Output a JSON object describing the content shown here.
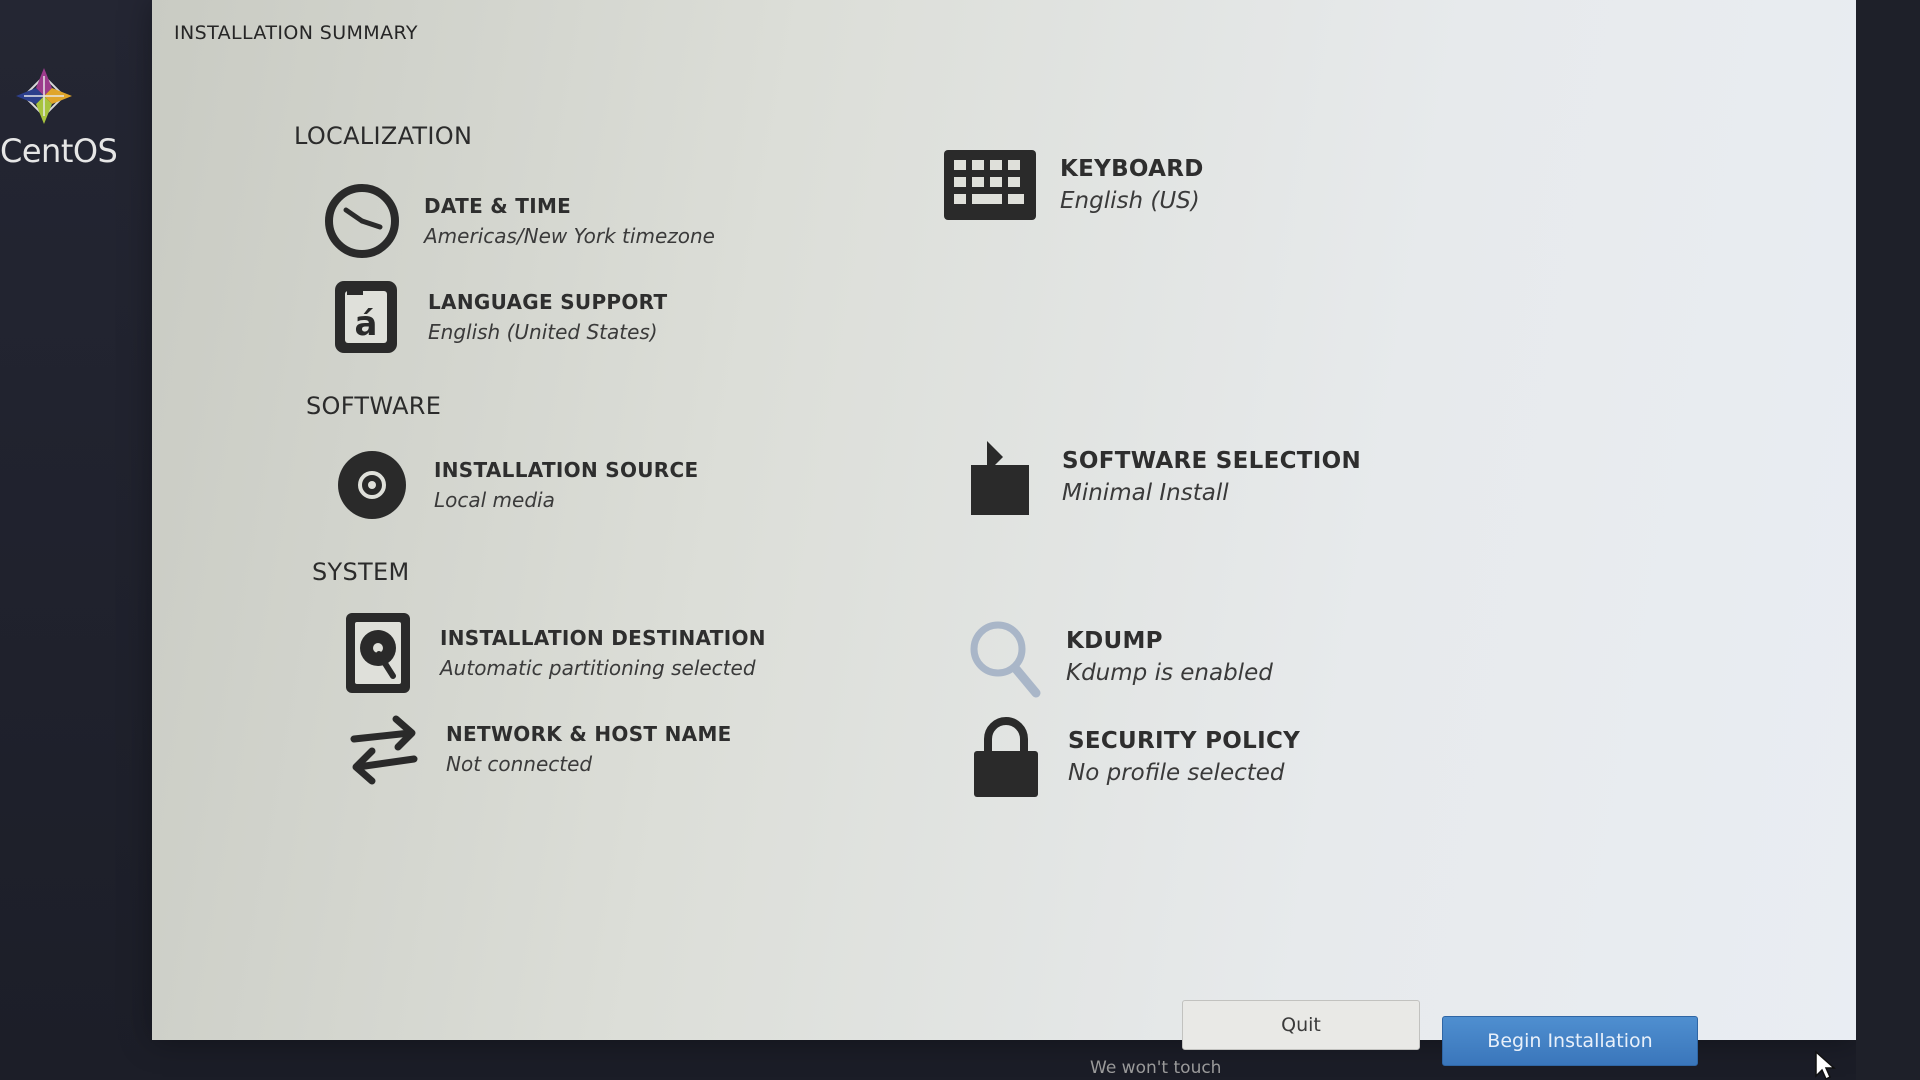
{
  "sidebar": {
    "logo_text": "CentOS"
  },
  "page_title": "INSTALLATION SUMMARY",
  "sections": {
    "localization": "LOCALIZATION",
    "software": "SOFTWARE",
    "system": "SYSTEM"
  },
  "spokes": {
    "date_time": {
      "label": "DATE & TIME",
      "status": "Americas/New York timezone"
    },
    "keyboard": {
      "label": "KEYBOARD",
      "status": "English (US)"
    },
    "language": {
      "label": "LANGUAGE SUPPORT",
      "status": "English (United States)"
    },
    "install_source": {
      "label": "INSTALLATION SOURCE",
      "status": "Local media"
    },
    "software_selection": {
      "label": "SOFTWARE SELECTION",
      "status": "Minimal Install"
    },
    "install_destination": {
      "label": "INSTALLATION DESTINATION",
      "status": "Automatic partitioning selected"
    },
    "kdump": {
      "label": "KDUMP",
      "status": "Kdump is enabled"
    },
    "network": {
      "label": "NETWORK & HOST NAME",
      "status": "Not connected"
    },
    "security": {
      "label": "SECURITY POLICY",
      "status": "No profile selected"
    }
  },
  "buttons": {
    "quit": "Quit",
    "begin": "Begin Installation"
  },
  "hint": "We won't touch",
  "colors": {
    "accent": "#3a76bb",
    "icon": "#2a2a2a",
    "kdump_icon": "#a9b6c8"
  }
}
